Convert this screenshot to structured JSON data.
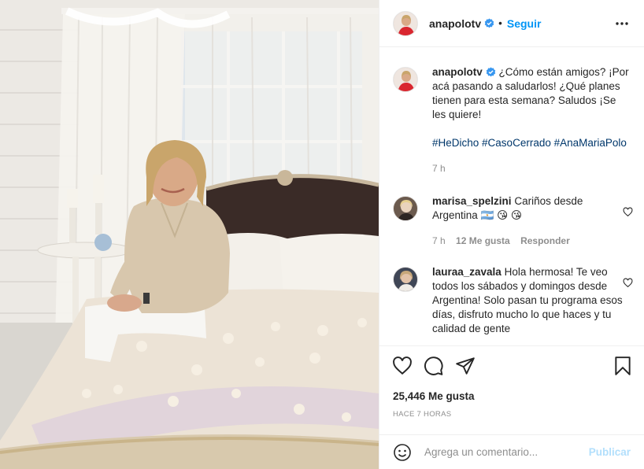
{
  "colors": {
    "accent_blue": "#0095f6",
    "hashtag_blue": "#00376b",
    "muted_grey": "#8e8e8e",
    "publish_disabled": "#b2dffc",
    "verified_badge": "#3897f0"
  },
  "icons": {
    "verified": "verified-badge-icon",
    "more": "more-options-icon",
    "like": "heart-icon",
    "comment": "comment-bubble-icon",
    "share": "paper-plane-icon",
    "save": "bookmark-icon",
    "emoji": "smiley-icon"
  },
  "header": {
    "username": "anapolotv",
    "separator": "•",
    "follow_label": "Seguir"
  },
  "caption": {
    "username": "anapolotv",
    "text": "¿Cómo están amigos? ¡Por acá pasando a saludarlos! ¿Qué planes tienen para esta semana? Saludos ¡Se les quiere!",
    "hashtags": [
      "#HeDicho",
      "#CasoCerrado",
      "#AnaMariaPolo"
    ],
    "time": "7 h"
  },
  "comments": [
    {
      "username": "marisa_spelzini",
      "text": "Cariños desde Argentina 🇦🇷 😘 😘",
      "time": "7 h",
      "likes": "12 Me gusta",
      "reply_label": "Responder"
    },
    {
      "username": "lauraa_zavala",
      "text": "Hola hermosa! Te veo todos los sábados y domingos desde Argentina! Solo pasan tu programa esos días, disfruto mucho lo que haces y tu calidad de gente"
    }
  ],
  "post": {
    "likes_count": "25,446 Me gusta",
    "timestamp": "HACE 7 HORAS"
  },
  "add_comment": {
    "placeholder": "Agrega un comentario...",
    "publish_label": "Publicar"
  }
}
